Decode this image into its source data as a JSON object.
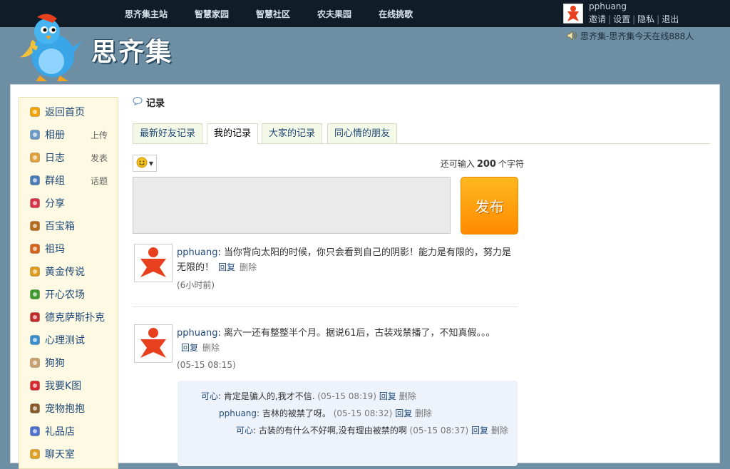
{
  "topnav": [
    "思齐集主站",
    "智慧家园",
    "智慧社区",
    "农夫果园",
    "在线挑歌"
  ],
  "user": {
    "name": "pphuang",
    "links": [
      "邀请",
      "设置",
      "隐私",
      "退出"
    ]
  },
  "notice": "思齐集-思齐集今天在线888人",
  "logo": "思齐集",
  "sidebar": [
    {
      "label": "返回首页",
      "sub": "",
      "icon": "home-icon",
      "color": "#f3a400"
    },
    {
      "label": "相册",
      "sub": "上传",
      "icon": "photo-icon",
      "color": "#6b9ac7"
    },
    {
      "label": "日志",
      "sub": "发表",
      "icon": "journal-icon",
      "color": "#e2a13b"
    },
    {
      "label": "群组",
      "sub": "话题",
      "icon": "group-icon",
      "color": "#4a7ab8"
    },
    {
      "label": "分享",
      "sub": "",
      "icon": "heart-icon",
      "color": "#d9334a"
    },
    {
      "label": "百宝箱",
      "sub": "",
      "icon": "treasure-icon",
      "color": "#b56a1c"
    },
    {
      "label": "祖玛",
      "sub": "",
      "icon": "zuma-icon",
      "color": "#d7631b"
    },
    {
      "label": "黄金传说",
      "sub": "",
      "icon": "gold-icon",
      "color": "#e09c1a"
    },
    {
      "label": "开心农场",
      "sub": "",
      "icon": "sprout-icon",
      "color": "#3c9a2a"
    },
    {
      "label": "德克萨斯扑克",
      "sub": "",
      "icon": "poker-icon",
      "color": "#c42b2b"
    },
    {
      "label": "心理测试",
      "sub": "",
      "icon": "flask-icon",
      "color": "#3a8fd1"
    },
    {
      "label": "狗狗",
      "sub": "",
      "icon": "dog-icon",
      "color": "#c9a070"
    },
    {
      "label": "我要K图",
      "sub": "",
      "icon": "kpic-icon",
      "color": "#d8282f"
    },
    {
      "label": "宠物抱抱",
      "sub": "",
      "icon": "paw-icon",
      "color": "#8a5a2b"
    },
    {
      "label": "礼品店",
      "sub": "",
      "icon": "gift-icon",
      "color": "#4c6fd0"
    },
    {
      "label": "聊天室",
      "sub": "",
      "icon": "chat-icon",
      "color": "#e0a020"
    }
  ],
  "title": "记录",
  "tabs": [
    "最新好友记录",
    "我的记录",
    "大家的记录",
    "同心情的朋友"
  ],
  "counter": {
    "prefix": "还可输入",
    "value": "200",
    "suffix": "个字符"
  },
  "publish_label": "发布",
  "posts": [
    {
      "author": "pphuang",
      "text": "当你背向太阳的时候，你只会看到自己的阴影！能力是有限的，努力是无限的！",
      "reply_label": "回复",
      "delete_label": "删除",
      "time": "(6小时前)"
    },
    {
      "author": "pphuang",
      "text": "离六一还有整整半个月。据说61后，古装戏禁播了，不知真假。。。",
      "reply_label": "回复",
      "delete_label": "删除",
      "time": "(05-15 08:15)"
    }
  ],
  "replies": [
    {
      "author": "可心",
      "text": "肯定是骗人的,我才不信.",
      "time": "(05-15 08:19)",
      "reply_label": "回复",
      "delete_label": "删除"
    },
    {
      "author": "pphuang",
      "text": "吉林的被禁了呀。",
      "time": "(05-15 08:32)",
      "reply_label": "回复",
      "delete_label": "删除"
    },
    {
      "author": "可心",
      "text": "古装的有什么不好啊,没有理由被禁的啊",
      "time": "(05-15 08:37)",
      "reply_label": "回复",
      "delete_label": "删除"
    }
  ]
}
